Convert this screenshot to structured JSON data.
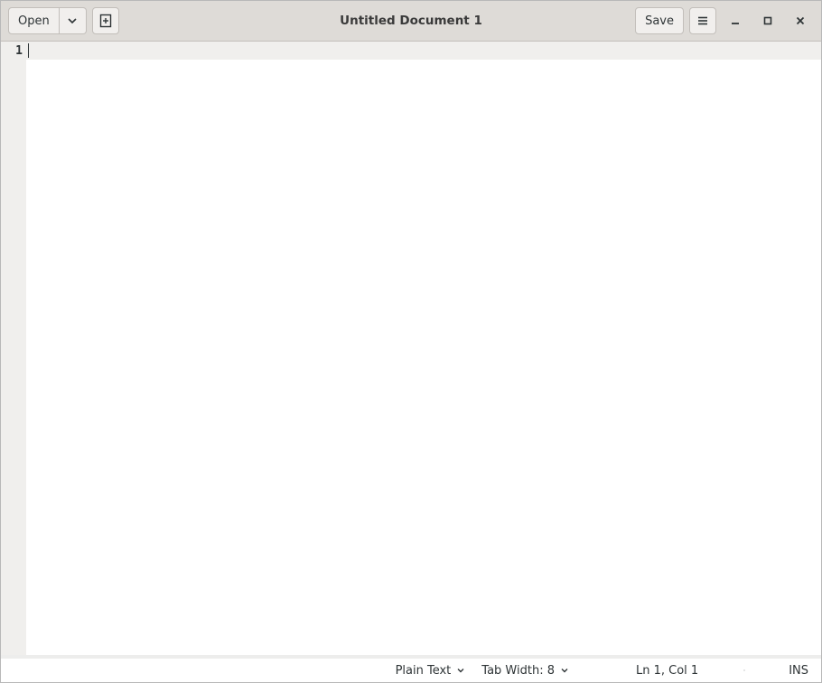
{
  "header": {
    "open_label": "Open",
    "save_label": "Save",
    "title": "Untitled Document 1"
  },
  "editor": {
    "line_numbers": [
      "1"
    ],
    "content": ""
  },
  "statusbar": {
    "language": "Plain Text",
    "tab_width_label": "Tab Width: 8",
    "position_label": "Ln 1, Col 1",
    "insert_mode": "INS"
  }
}
